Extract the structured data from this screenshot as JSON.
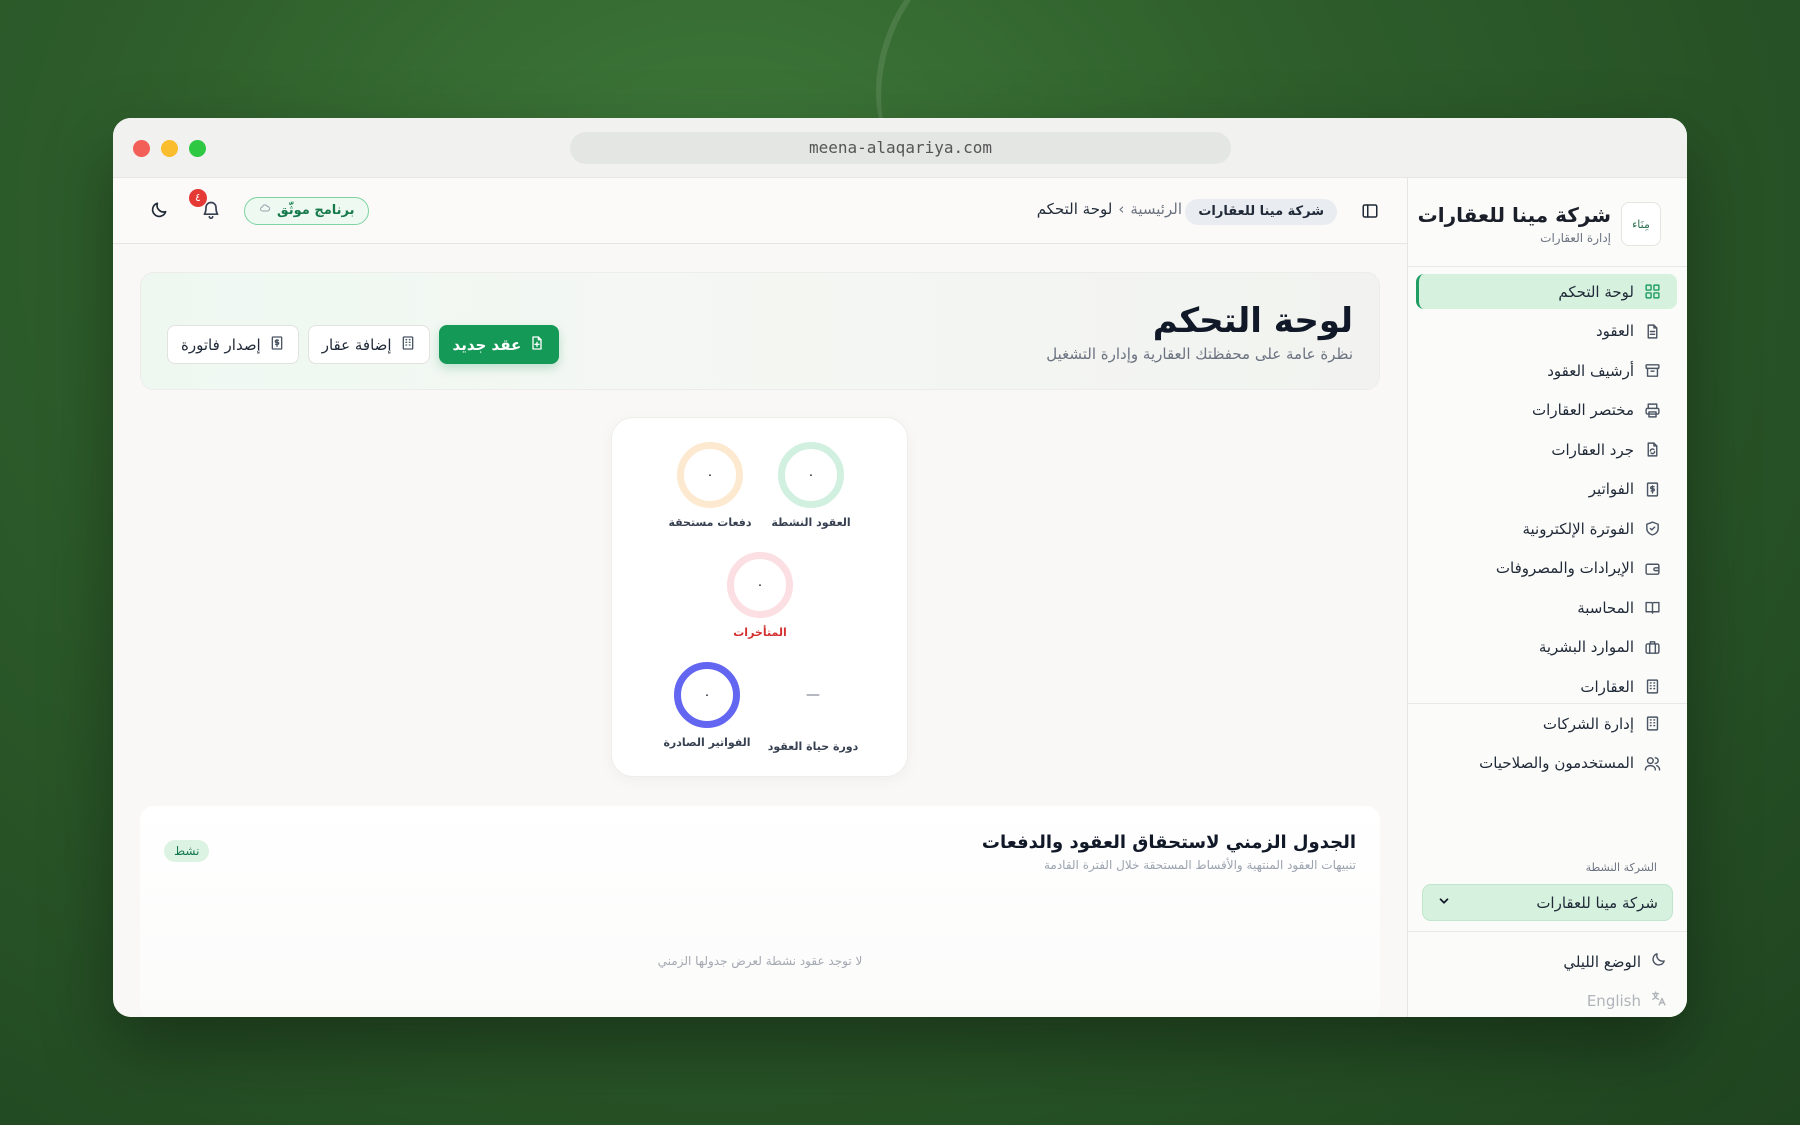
{
  "browser": {
    "url": "meena-alaqariya.com"
  },
  "brand": {
    "logo_text": "مِنَاء",
    "name": "شركة مينا للعقارات",
    "subtitle": "إدارة العقارات"
  },
  "sidebar": {
    "items": [
      {
        "label": "لوحة التحكم",
        "icon": "dashboard-grid-icon",
        "active": true
      },
      {
        "label": "العقود",
        "icon": "document-icon"
      },
      {
        "label": "أرشيف العقود",
        "icon": "archive-icon"
      },
      {
        "label": "مختصر العقارات",
        "icon": "printer-icon"
      },
      {
        "label": "جرد العقارات",
        "icon": "file-sync-icon"
      },
      {
        "label": "الفواتير",
        "icon": "invoice-dollar-icon"
      },
      {
        "label": "الفوترة الإلكترونية",
        "icon": "shield-check-icon"
      },
      {
        "label": "الإيرادات والمصروفات",
        "icon": "wallet-icon"
      },
      {
        "label": "المحاسبة",
        "icon": "book-open-icon"
      },
      {
        "label": "الموارد البشرية",
        "icon": "briefcase-icon"
      },
      {
        "label": "العقارات",
        "icon": "building-icon"
      }
    ],
    "admin_items": [
      {
        "label": "إدارة الشركات",
        "icon": "building-icon"
      },
      {
        "label": "المستخدمون والصلاحيات",
        "icon": "users-icon"
      }
    ],
    "active_company_label": "الشركة النشطة",
    "active_company_value": "شركة مينا للعقارات",
    "dark_mode_label": "الوضع الليلي",
    "language_label": "English"
  },
  "header": {
    "company_chip": "شركة مينا للعقارات",
    "breadcrumb": {
      "home": "الرئيسية",
      "separator": "›",
      "current": "لوحة التحكم"
    },
    "verified_label": "برنامج موثّق",
    "notification_count": "٤"
  },
  "hero": {
    "title": "لوحة التحكم",
    "subtitle": "نظرة عامة على محفظتك العقارية وإدارة التشغيل",
    "actions": {
      "new_contract": "عقد جديد",
      "add_property": "إضافة عقار",
      "issue_invoice": "إصدار فاتورة"
    }
  },
  "stats": {
    "active_contracts": {
      "value": "٠",
      "label": "العقود النشطة",
      "color": "#d1f0e0"
    },
    "due_payments": {
      "value": "٠",
      "label": "دفعات مستحقة",
      "color": "#fde9cf"
    },
    "overdue": {
      "value": "٠",
      "label": "المتأخرات",
      "color": "#fcdfe2",
      "label_color": "#d32f2f"
    },
    "lifecycle": {
      "value": "—",
      "label": "دورة حياة العقود"
    },
    "issued_invoices": {
      "value": "٠",
      "label": "الفواتير الصادرة",
      "color": "#6366f1"
    }
  },
  "timeline": {
    "title": "الجدول الزمني لاستحقاق العقود والدفعات",
    "subtitle": "تنبيهات العقود المنتهية والأقساط المستحقة خلال الفترة القادمة",
    "status": "نشط",
    "empty": "لا توجد عقود نشطة لعرض جدولها الزمني"
  }
}
